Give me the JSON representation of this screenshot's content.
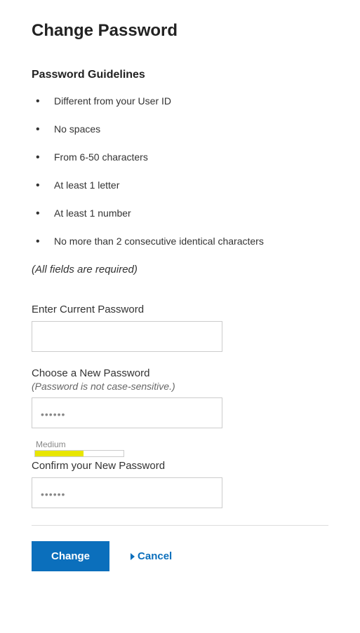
{
  "title": "Change Password",
  "guidelines": {
    "heading": "Password Guidelines",
    "items": [
      "Different from your User ID",
      "No spaces",
      "From 6-50 characters",
      "At least 1 letter",
      "At least 1 number",
      "No more than 2 consecutive identical characters"
    ]
  },
  "required_note": "(All fields are required)",
  "fields": {
    "current": {
      "label": "Enter Current Password",
      "value": ""
    },
    "new": {
      "label": "Choose a New Password",
      "hint": "(Password is not case-sensitive.)",
      "value": "••••••"
    },
    "strength": {
      "label": "Medium",
      "percent": 55
    },
    "confirm": {
      "label": "Confirm your New Password",
      "value": "••••••"
    }
  },
  "actions": {
    "change": "Change",
    "cancel": "Cancel"
  }
}
